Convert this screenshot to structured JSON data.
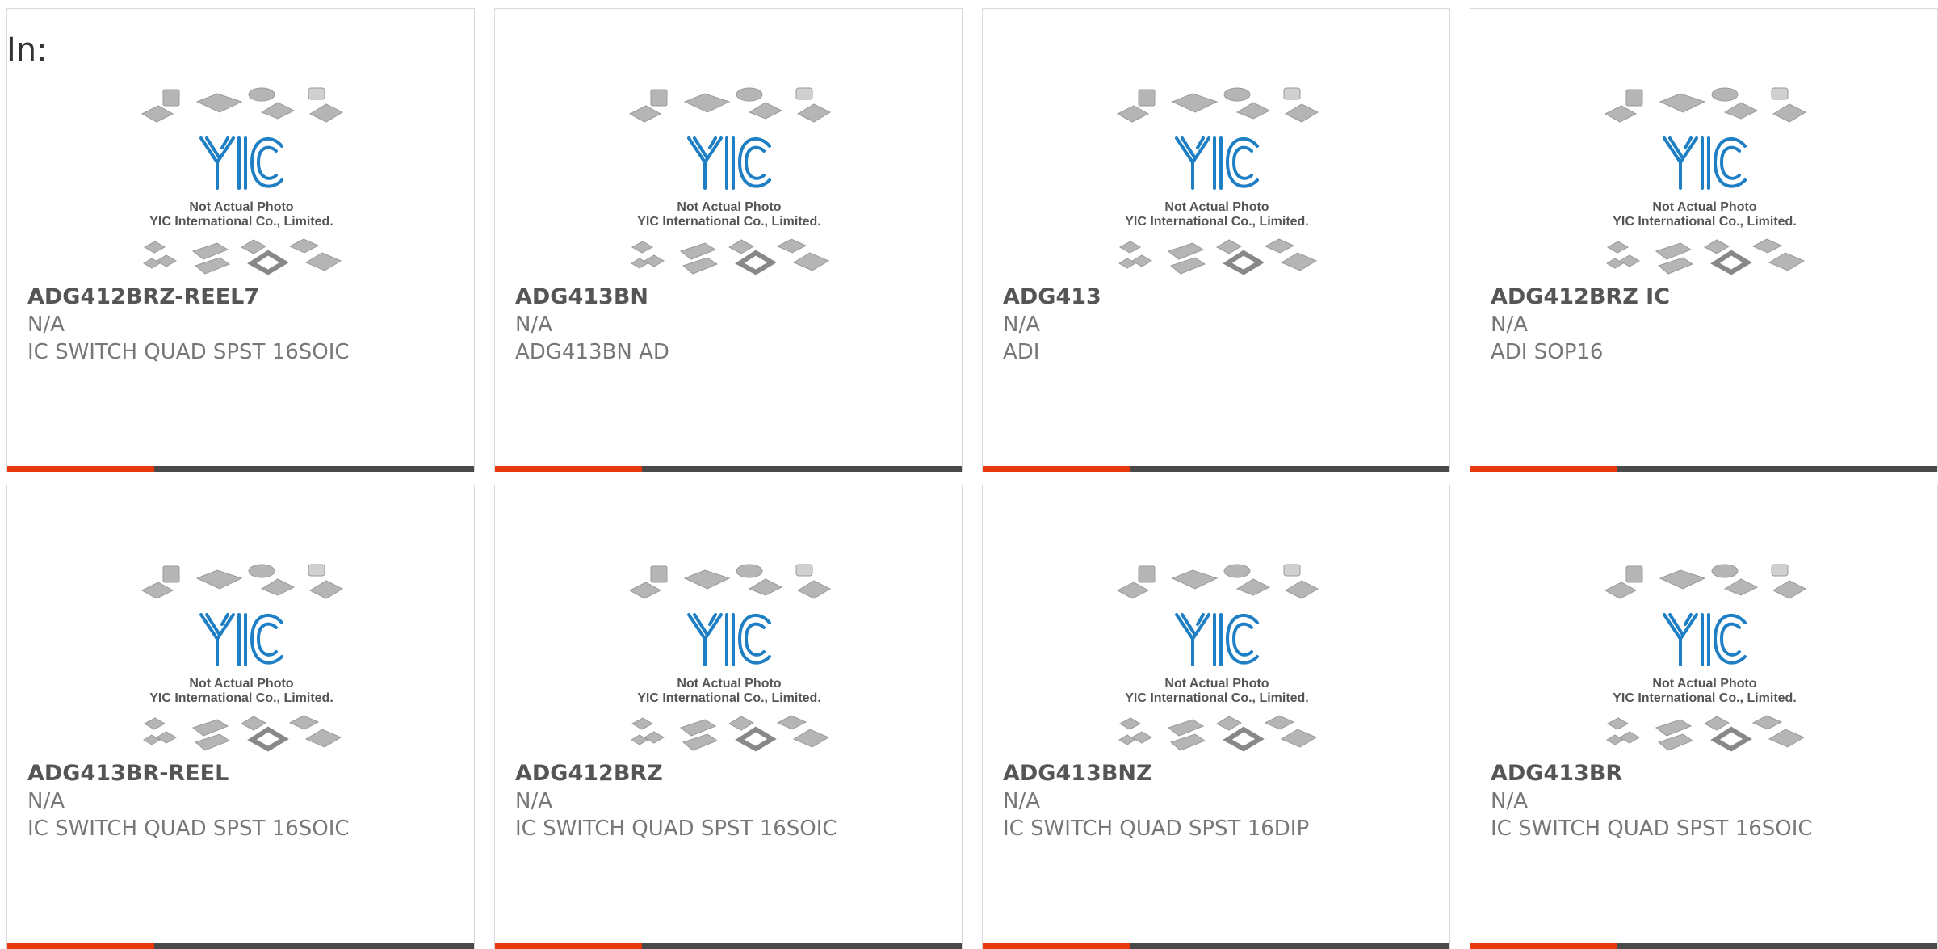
{
  "header": {
    "label": "In:"
  },
  "colors": {
    "accent": "#e8380d",
    "bar": "#4a4a4a",
    "logo": "#1e7fc4"
  },
  "image": {
    "line1": "Not Actual Photo",
    "line2": "YIC International Co., Limited.",
    "logo": "YIC"
  },
  "products": [
    {
      "part_number": "ADG412BRZ-REEL7",
      "manufacturer": "N/A",
      "description": "IC SWITCH QUAD SPST 16SOIC"
    },
    {
      "part_number": "ADG413BN",
      "manufacturer": "N/A",
      "description": "ADG413BN AD"
    },
    {
      "part_number": "ADG413",
      "manufacturer": "N/A",
      "description": "ADI"
    },
    {
      "part_number": "ADG412BRZ IC",
      "manufacturer": "N/A",
      "description": "ADI SOP16"
    },
    {
      "part_number": "ADG413BR-REEL",
      "manufacturer": "N/A",
      "description": "IC SWITCH QUAD SPST 16SOIC"
    },
    {
      "part_number": "ADG412BRZ",
      "manufacturer": "N/A",
      "description": "IC SWITCH QUAD SPST 16SOIC"
    },
    {
      "part_number": "ADG413BNZ",
      "manufacturer": "N/A",
      "description": "IC SWITCH QUAD SPST 16DIP"
    },
    {
      "part_number": "ADG413BR",
      "manufacturer": "N/A",
      "description": "IC SWITCH QUAD SPST 16SOIC"
    }
  ]
}
